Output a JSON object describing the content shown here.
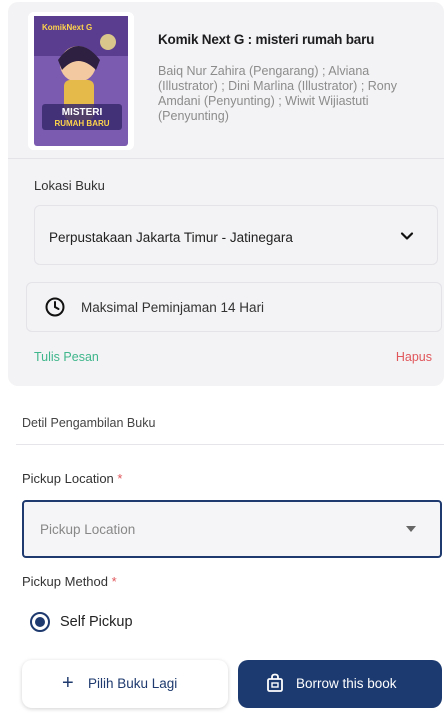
{
  "book": {
    "title": "Komik Next G : misteri rumah baru",
    "authors": "Baiq Nur Zahira (Pengarang) ; Alviana (Illustrator) ; Dini Marlina (Illustrator) ; Rony Amdani (Penyunting) ; Wiwit Wijiastuti (Penyunting)",
    "cover_brand": "KomikNext G",
    "cover_title_line1": "MISTERI",
    "cover_title_line2": "RUMAH BARU"
  },
  "lokasi": {
    "label": "Lokasi Buku",
    "selected": "Perpustakaan Jakarta Timur - Jatinegara"
  },
  "loan": {
    "max_text": "Maksimal Peminjaman 14 Hari"
  },
  "actions": {
    "write_message": "Tulis Pesan",
    "delete": "Hapus"
  },
  "pickup": {
    "section_title": "Detil Pengambilan Buku",
    "location_label": "Pickup Location",
    "location_placeholder": "Pickup Location",
    "method_label": "Pickup Method",
    "required_mark": "*",
    "method_option": "Self Pickup"
  },
  "footer": {
    "more_books": "Pilih Buku Lagi",
    "borrow": "Borrow this book"
  },
  "colors": {
    "primary": "#1c3a70",
    "success": "#3fb68b",
    "danger": "#e0565b"
  }
}
